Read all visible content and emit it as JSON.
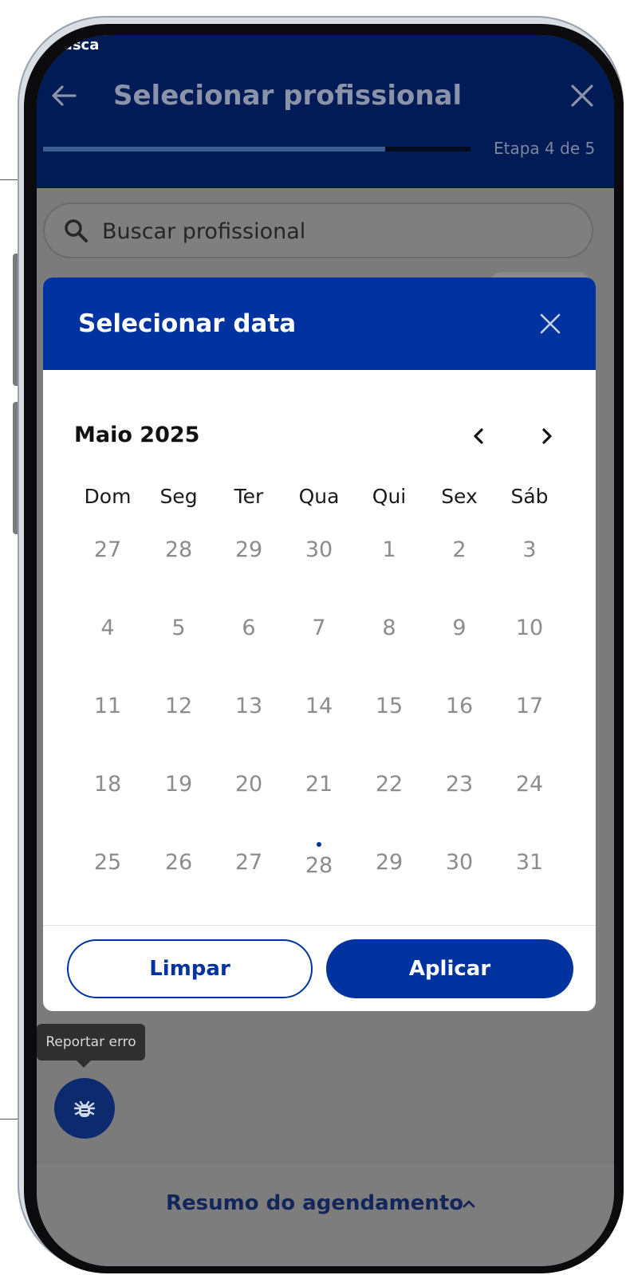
{
  "status": {
    "text": "usca"
  },
  "header": {
    "title": "Selecionar profissional",
    "step_label": "Etapa 4 de 5",
    "progress_fraction": 0.8,
    "back_icon": "arrow-left-icon",
    "close_icon": "close-icon"
  },
  "search": {
    "placeholder": "Buscar profissional",
    "icon": "search-icon"
  },
  "modal": {
    "title": "Selecionar data",
    "month": "Maio 2025",
    "weekdays": [
      "Dom",
      "Seg",
      "Ter",
      "Qua",
      "Qui",
      "Sex",
      "Sáb"
    ],
    "weeks": [
      [
        "27",
        "28",
        "29",
        "30",
        "1",
        "2",
        "3"
      ],
      [
        "4",
        "5",
        "6",
        "7",
        "8",
        "9",
        "10"
      ],
      [
        "11",
        "12",
        "13",
        "14",
        "15",
        "16",
        "17"
      ],
      [
        "18",
        "19",
        "20",
        "21",
        "22",
        "23",
        "24"
      ],
      [
        "25",
        "26",
        "27",
        "28",
        "29",
        "30",
        "31"
      ]
    ],
    "today_marker": {
      "week": 4,
      "weekday": 3
    },
    "clear_label": "Limpar",
    "apply_label": "Aplicar"
  },
  "report": {
    "tooltip": "Reportar erro",
    "icon": "bug-icon"
  },
  "bottom": {
    "summary_label": "Resumo do agendamento",
    "icon": "chevron-up-icon"
  },
  "colors": {
    "primary": "#0033a0",
    "header_bg": "#011b57",
    "overlay": "#7b7b7b"
  }
}
